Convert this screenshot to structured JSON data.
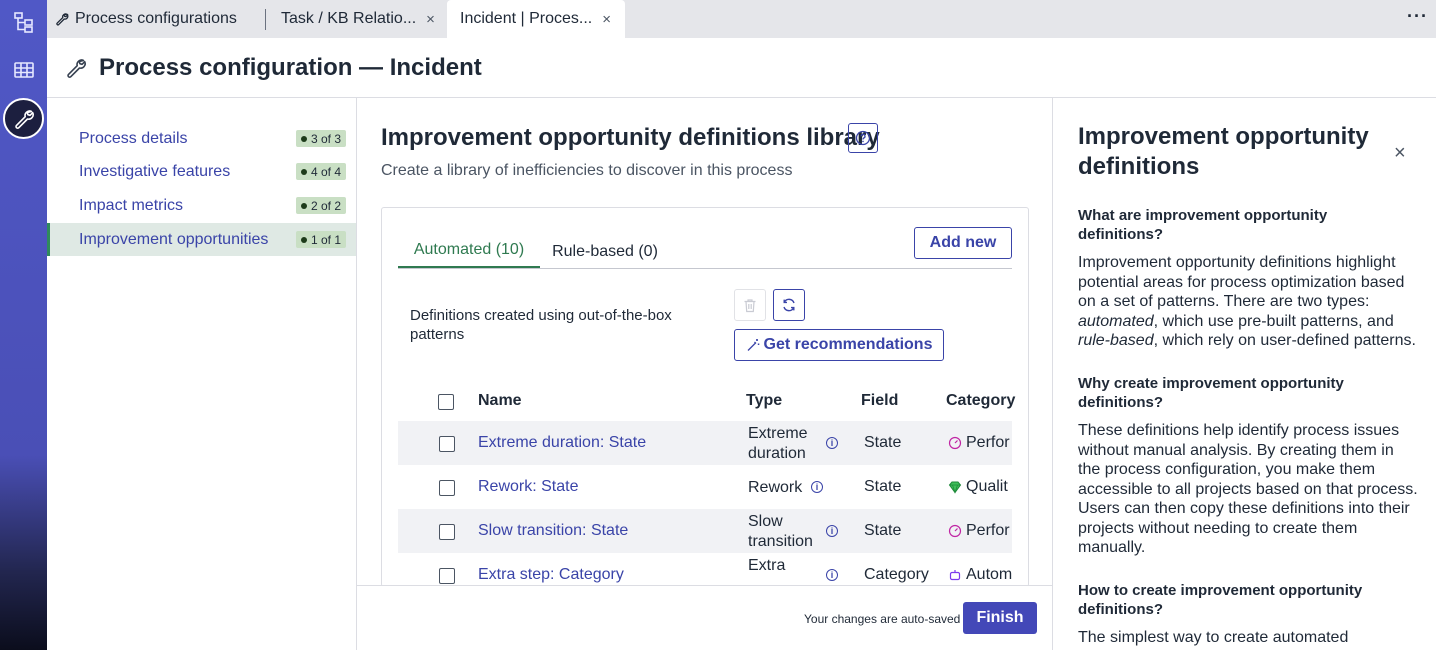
{
  "tabs": [
    {
      "label": "Process configurations"
    },
    {
      "label": "Task / KB Relatio...",
      "close": "×"
    },
    {
      "label": "Incident | Proces...",
      "close": "×"
    }
  ],
  "more_label": "···",
  "header": {
    "title": "Process configuration — Incident"
  },
  "nav": [
    {
      "label": "Process details",
      "badge": "3 of 3"
    },
    {
      "label": "Investigative features",
      "badge": "4 of 4"
    },
    {
      "label": "Impact metrics",
      "badge": "2 of 2"
    },
    {
      "label": "Improvement opportunities",
      "badge": "1 of 1"
    }
  ],
  "main": {
    "title": "Improvement opportunity definitions library",
    "subtitle": "Create a library of inefficiencies to discover in this process",
    "tabs": [
      {
        "label": "Automated (10)"
      },
      {
        "label": "Rule-based (0)"
      }
    ],
    "add_new": "Add new",
    "description": "Definitions created using out-of-the-box patterns",
    "get_recommendations": "Get recommendations",
    "columns": {
      "name": "Name",
      "type": "Type",
      "field": "Field",
      "category": "Category"
    },
    "rows": [
      {
        "name": "Extreme duration: State",
        "type": "Extreme duration",
        "field": "State",
        "category": "Perfor"
      },
      {
        "name": "Rework: State",
        "type": "Rework",
        "field": "State",
        "category": "Qualit"
      },
      {
        "name": "Slow transition: State",
        "type": "Slow transition",
        "field": "State",
        "category": "Perfor"
      },
      {
        "name": "Extra step: Category",
        "type": "Extra",
        "field": "Category",
        "category": "Autom"
      }
    ],
    "autosave": "Your changes are auto-saved",
    "finish": "Finish"
  },
  "colors": {
    "accent": "#3a44a8",
    "active_tab": "#2f7a50",
    "rail": "#4a4fb6",
    "finish": "#4348b8"
  },
  "panel": {
    "title": "Improvement opportunity definitions",
    "close": "×",
    "q1": "What are improvement opportunity definitions?",
    "a1_start": "Improvement opportunity definitions highlight potential areas for process optimization based on a set of patterns. There are two types: ",
    "a1_em1": "automated",
    "a1_mid": ", which use pre-built patterns, and ",
    "a1_em2": "rule-based",
    "a1_end": ", which rely on user-defined patterns.",
    "q2": "Why create improvement opportunity definitions?",
    "a2": "These definitions help identify process issues without manual analysis. By creating them in the process configuration, you make them accessible to all projects based on that process. Users can then copy these definitions into their projects without needing to create them manually.",
    "q3": "How to create improvement opportunity definitions?",
    "a3": "The simplest way to create automated"
  }
}
